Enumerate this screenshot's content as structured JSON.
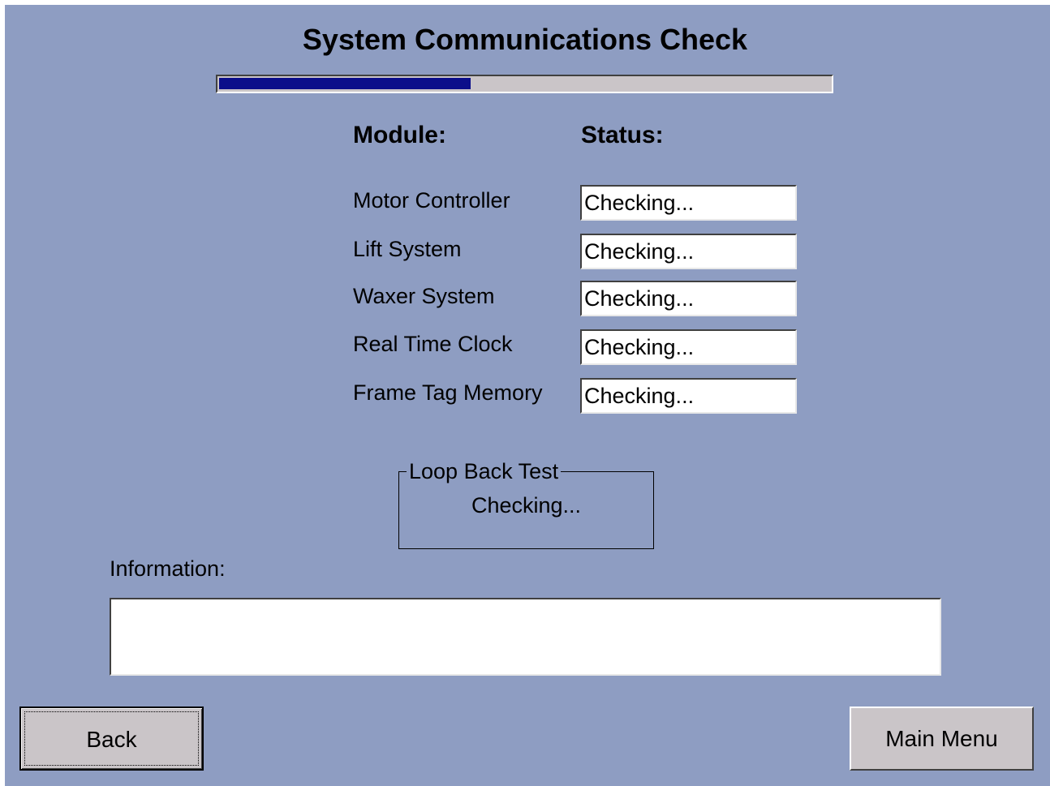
{
  "title": "System Communications Check",
  "progress": {
    "fraction": 0.41,
    "fill_color": "#0b0e8a",
    "track_color": "#cac5c8"
  },
  "headers": {
    "module": "Module:",
    "status": "Status:"
  },
  "modules": [
    {
      "label": "Motor Controller",
      "status": "Checking..."
    },
    {
      "label": "Lift System",
      "status": "Checking..."
    },
    {
      "label": "Waxer System",
      "status": "Checking..."
    },
    {
      "label": "Real Time Clock",
      "status": "Checking..."
    },
    {
      "label": "Frame Tag Memory",
      "status": "Checking..."
    }
  ],
  "loop_back": {
    "title": "Loop Back Test",
    "status": "Checking..."
  },
  "information": {
    "label": "Information:",
    "value": ""
  },
  "buttons": {
    "back": "Back",
    "main_menu": "Main Menu"
  },
  "colors": {
    "background": "#8e9dc2",
    "button_face": "#cac5c8"
  }
}
